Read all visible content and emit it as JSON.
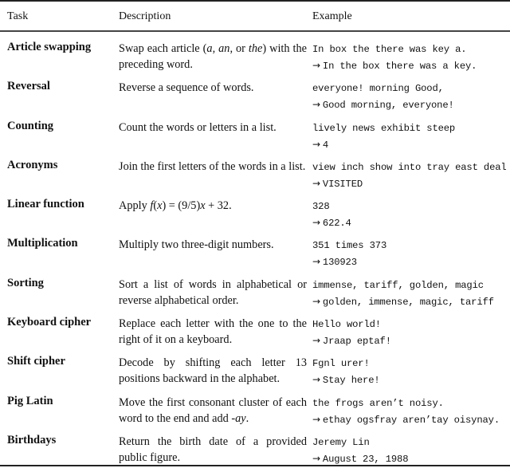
{
  "header": {
    "task": "Task",
    "description": "Description",
    "example": "Example"
  },
  "arrow_symbol": "→",
  "rows": [
    {
      "task": "Article swapping",
      "description_parts": [
        {
          "text": "Swap each article (",
          "italic": false
        },
        {
          "text": "a",
          "italic": true
        },
        {
          "text": ", ",
          "italic": false
        },
        {
          "text": "an",
          "italic": true
        },
        {
          "text": ", or ",
          "italic": false
        },
        {
          "text": "the",
          "italic": true
        },
        {
          "text": ") with the preceding word.",
          "italic": false
        }
      ],
      "input": "In box the there was key a.",
      "output": "In the box there was a key."
    },
    {
      "task": "Reversal",
      "description_parts": [
        {
          "text": "Reverse a sequence of words.",
          "italic": false
        }
      ],
      "input": "everyone! morning Good,",
      "output": "Good morning, everyone!"
    },
    {
      "task": "Counting",
      "description_parts": [
        {
          "text": "Count the words or letters in a list.",
          "italic": false
        }
      ],
      "input": "lively news exhibit steep",
      "output": "4"
    },
    {
      "task": "Acronyms",
      "description_parts": [
        {
          "text": "Join the first letters of the words in a list.",
          "italic": false
        }
      ],
      "input": "view inch show into tray east deal",
      "output": "VISITED"
    },
    {
      "task": "Linear function",
      "description_parts": [
        {
          "text": "Apply ",
          "italic": false
        },
        {
          "text": "f",
          "italic": true
        },
        {
          "text": "(",
          "italic": false
        },
        {
          "text": "x",
          "italic": true
        },
        {
          "text": ") = (9/5)",
          "italic": false
        },
        {
          "text": "x",
          "italic": true
        },
        {
          "text": " + 32.",
          "italic": false
        }
      ],
      "input": "328",
      "output": "622.4"
    },
    {
      "task": "Multiplication",
      "description_parts": [
        {
          "text": "Multiply two three-digit numbers.",
          "italic": false
        }
      ],
      "input": "351 times 373",
      "output": "130923"
    },
    {
      "task": "Sorting",
      "description_parts": [
        {
          "text": "Sort a list of words in alphabetical or reverse alphabetical order.",
          "italic": false
        }
      ],
      "input": "immense, tariff, golden, magic",
      "output": "golden, immense, magic, tariff"
    },
    {
      "task": "Keyboard cipher",
      "description_parts": [
        {
          "text": "Replace each letter with the one to the right of it on a keyboard.",
          "italic": false
        }
      ],
      "input": "Hello world!",
      "output": "Jraap eptaf!"
    },
    {
      "task": "Shift cipher",
      "description_parts": [
        {
          "text": "Decode by shifting each letter 13 positions backward in the alphabet.",
          "italic": false
        }
      ],
      "input": "Fgnl urer!",
      "output": "Stay here!"
    },
    {
      "task": "Pig Latin",
      "description_parts": [
        {
          "text": "Move the first consonant cluster of each word to the end and add ",
          "italic": false
        },
        {
          "text": "-ay",
          "italic": true
        },
        {
          "text": ".",
          "italic": false
        }
      ],
      "input": "the frogs aren’t noisy.",
      "output": "ethay ogsfray aren’tay oisynay."
    },
    {
      "task": "Birthdays",
      "description_parts": [
        {
          "text": "Return the birth date of a provided public figure.",
          "italic": false
        }
      ],
      "input": "Jeremy Lin",
      "output": "August 23, 1988"
    }
  ]
}
